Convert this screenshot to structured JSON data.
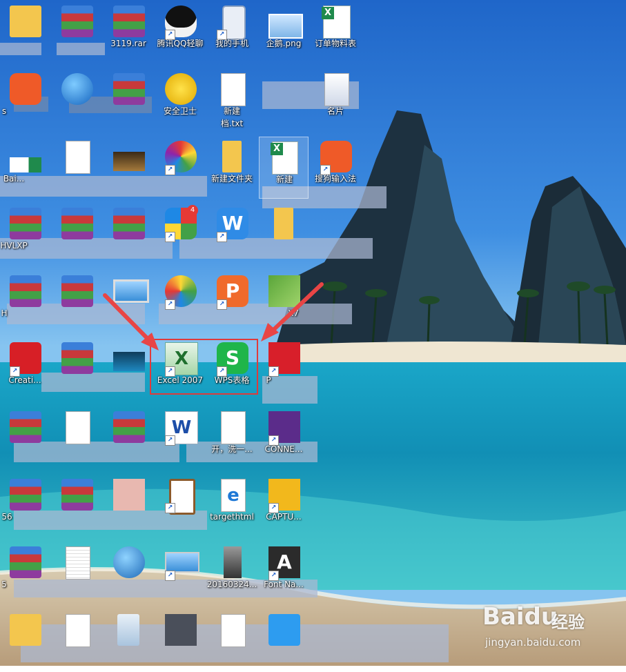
{
  "desktop": {
    "icons": [
      {
        "id": "zip-3119",
        "label": "3119.rar"
      },
      {
        "id": "qq",
        "label": "腾讯QQ轻聊"
      },
      {
        "id": "my-phone",
        "label": "我的手机"
      },
      {
        "id": "png",
        "label": "企鹅.png"
      },
      {
        "id": "excel-order",
        "label": "订单物料表"
      },
      {
        "id": "guard",
        "label": "安全卫士"
      },
      {
        "id": "txt",
        "label": "新建"
      },
      {
        "id": "txt2",
        "label": "档.txt"
      },
      {
        "id": "card",
        "label": "名片"
      },
      {
        "id": "folder-new",
        "label": "新建文件夹"
      },
      {
        "id": "new-sheet",
        "label": "新建"
      },
      {
        "id": "sogou",
        "label": "搜狗输入法"
      },
      {
        "id": "excel2007",
        "label": "Excel 2007"
      },
      {
        "id": "wps",
        "label": "WPS表格"
      },
      {
        "id": "cx7",
        "label": "X7"
      },
      {
        "id": "conne",
        "label": "CONNE..."
      },
      {
        "id": "target",
        "label": "targethtml"
      },
      {
        "id": "captu",
        "label": "CAPTU..."
      },
      {
        "id": "date",
        "label": "20160324..."
      },
      {
        "id": "fontna",
        "label": "Font Na..."
      },
      {
        "id": "creat",
        "label": "Creati..."
      },
      {
        "id": "b1",
        "label": "Bai..."
      },
      {
        "id": "h1",
        "label": "HVLXP"
      },
      {
        "id": "h2",
        "label": "H"
      },
      {
        "id": "s1",
        "label": "s"
      },
      {
        "id": "n56",
        "label": "56"
      },
      {
        "id": "n5",
        "label": "5"
      },
      {
        "id": "p1",
        "label": "P"
      },
      {
        "id": "wash",
        "label": "开，洗一..."
      }
    ],
    "badge_count": "4"
  },
  "watermark": {
    "brand": "Baidu",
    "cn": "经验",
    "url": "jingyan.baidu.com"
  },
  "colors": {
    "highlight": "#e03a3a",
    "arrow": "#e84545"
  }
}
